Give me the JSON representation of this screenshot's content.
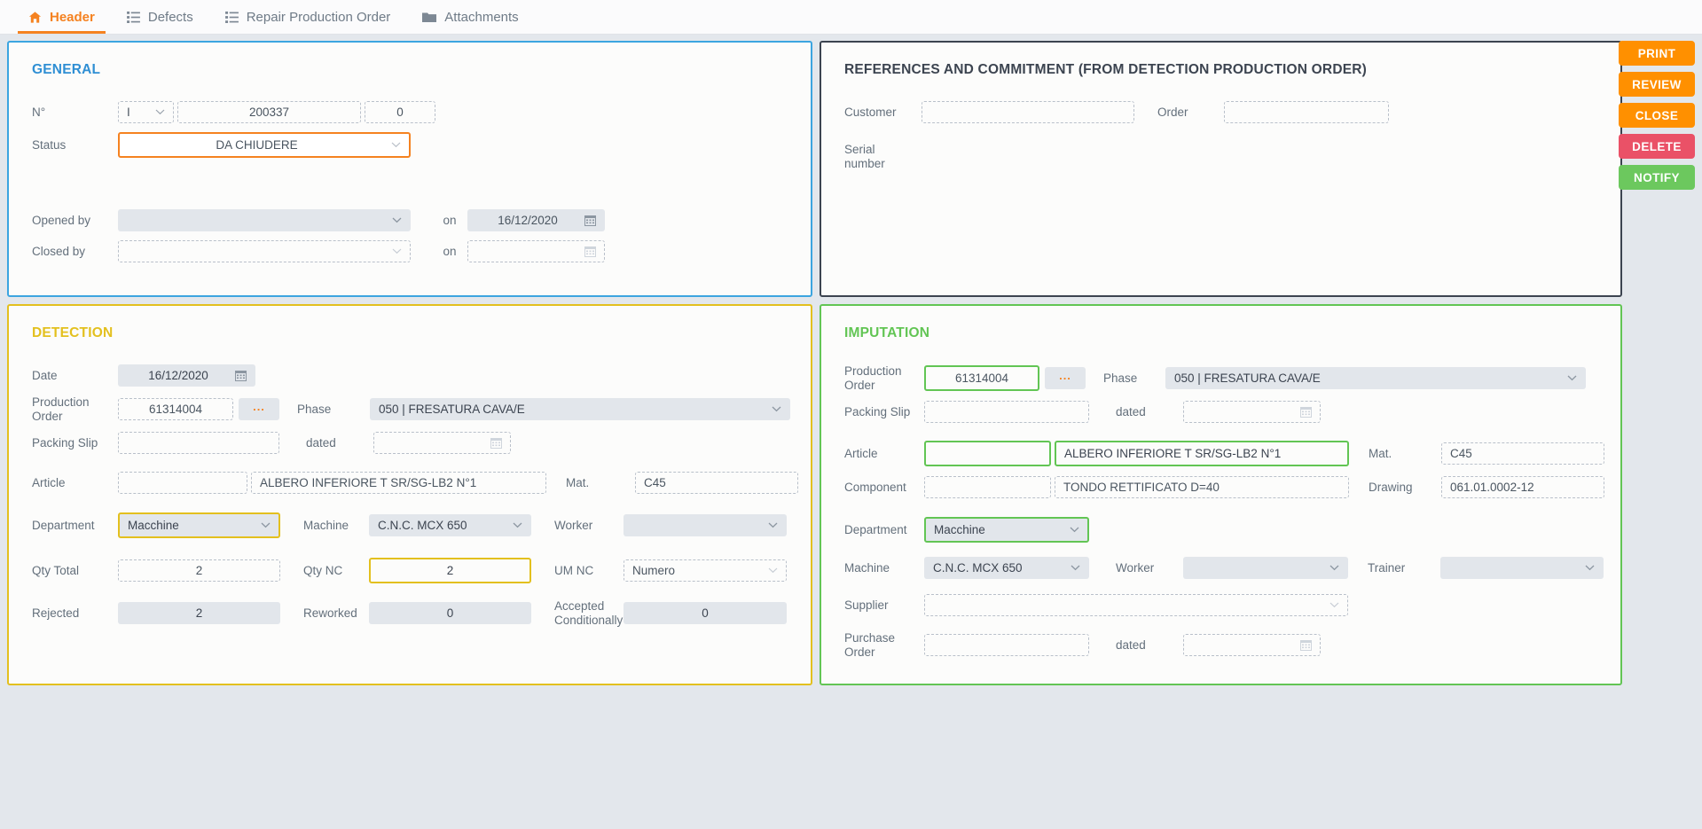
{
  "tabs": [
    {
      "label": "Header",
      "icon": "home-icon",
      "active": true
    },
    {
      "label": "Defects",
      "icon": "list-icon",
      "active": false
    },
    {
      "label": "Repair Production Order",
      "icon": "list-icon",
      "active": false
    },
    {
      "label": "Attachments",
      "icon": "folder-icon",
      "active": false
    }
  ],
  "general": {
    "title": "GENERAL",
    "accent": "#3ca5e0",
    "number_label": "N°",
    "number_prefix": "I",
    "number_main": "200337",
    "number_suffix": "0",
    "status_label": "Status",
    "status_value": "DA CHIUDERE",
    "opened_by_label": "Opened by",
    "opened_by_value": "",
    "opened_on_label": "on",
    "opened_on_value": "16/12/2020",
    "closed_by_label": "Closed by",
    "closed_by_value": "",
    "closed_on_label": "on",
    "closed_on_value": ""
  },
  "references": {
    "title": "REFERENCES AND COMMITMENT (FROM DETECTION PRODUCTION ORDER)",
    "accent": "#3c4450",
    "customer_label": "Customer",
    "customer_value": "",
    "order_label": "Order",
    "order_value": "",
    "serial_label_line1": "Serial",
    "serial_label_line2": "number"
  },
  "detection": {
    "title": "DETECTION",
    "accent": "#e3c01e",
    "date_label": "Date",
    "date_value": "16/12/2020",
    "po_label_line1": "Production",
    "po_label_line2": "Order",
    "po_value": "61314004",
    "po_browse": "...",
    "phase_label": "Phase",
    "phase_value": "050 | FRESATURA CAVA/E",
    "packing_label": "Packing Slip",
    "packing_value": "",
    "dated_label": "dated",
    "dated_value": "",
    "article_label": "Article",
    "article_code": "",
    "article_desc": "ALBERO INFERIORE T SR/SG-LB2 N°1",
    "mat_label": "Mat.",
    "mat_value": "C45",
    "department_label": "Department",
    "department_value": "Macchine",
    "machine_label": "Machine",
    "machine_value": "C.N.C. MCX 650",
    "worker_label": "Worker",
    "worker_value": "",
    "qty_total_label": "Qty Total",
    "qty_total_value": "2",
    "qty_nc_label": "Qty NC",
    "qty_nc_value": "2",
    "um_nc_label": "UM NC",
    "um_nc_value": "Numero",
    "rejected_label": "Rejected",
    "rejected_value": "2",
    "reworked_label": "Reworked",
    "reworked_value": "0",
    "accepted_label_line1": "Accepted",
    "accepted_label_line2": "Conditionally",
    "accepted_value": "0"
  },
  "imputation": {
    "title": "IMPUTATION",
    "accent": "#62c554",
    "po_label_line1": "Production",
    "po_label_line2": "Order",
    "po_value": "61314004",
    "po_browse": "...",
    "phase_label": "Phase",
    "phase_value": "050 | FRESATURA CAVA/E",
    "packing_label": "Packing Slip",
    "packing_value": "",
    "dated_label": "dated",
    "dated_value": "",
    "article_label": "Article",
    "article_code": "",
    "article_desc": "ALBERO INFERIORE T SR/SG-LB2 N°1",
    "mat_label": "Mat.",
    "mat_value": "C45",
    "component_label": "Component",
    "component_code": "",
    "component_desc": "TONDO RETTIFICATO D=40",
    "drawing_label": "Drawing",
    "drawing_value": "061.01.0002-12",
    "department_label": "Department",
    "department_value": "Macchine",
    "machine_label": "Machine",
    "machine_value": "C.N.C. MCX 650",
    "worker_label": "Worker",
    "worker_value": "",
    "trainer_label": "Trainer",
    "trainer_value": "",
    "supplier_label": "Supplier",
    "supplier_value": "",
    "purchase_label_line1": "Purchase",
    "purchase_label_line2": "Order",
    "purchase_value": "",
    "purchase_dated_label": "dated",
    "purchase_dated_value": ""
  },
  "actions": [
    {
      "label": "PRINT",
      "color": "#ff9000",
      "style": "a-orange"
    },
    {
      "label": "REVIEW",
      "color": "#ff9000",
      "style": "a-orange"
    },
    {
      "label": "CLOSE",
      "color": "#ff9000",
      "style": "a-orange"
    },
    {
      "label": "DELETE",
      "color": "#ea5167",
      "style": "a-red"
    },
    {
      "label": "NOTIFY",
      "color": "#6cc85e",
      "style": "a-green"
    }
  ]
}
